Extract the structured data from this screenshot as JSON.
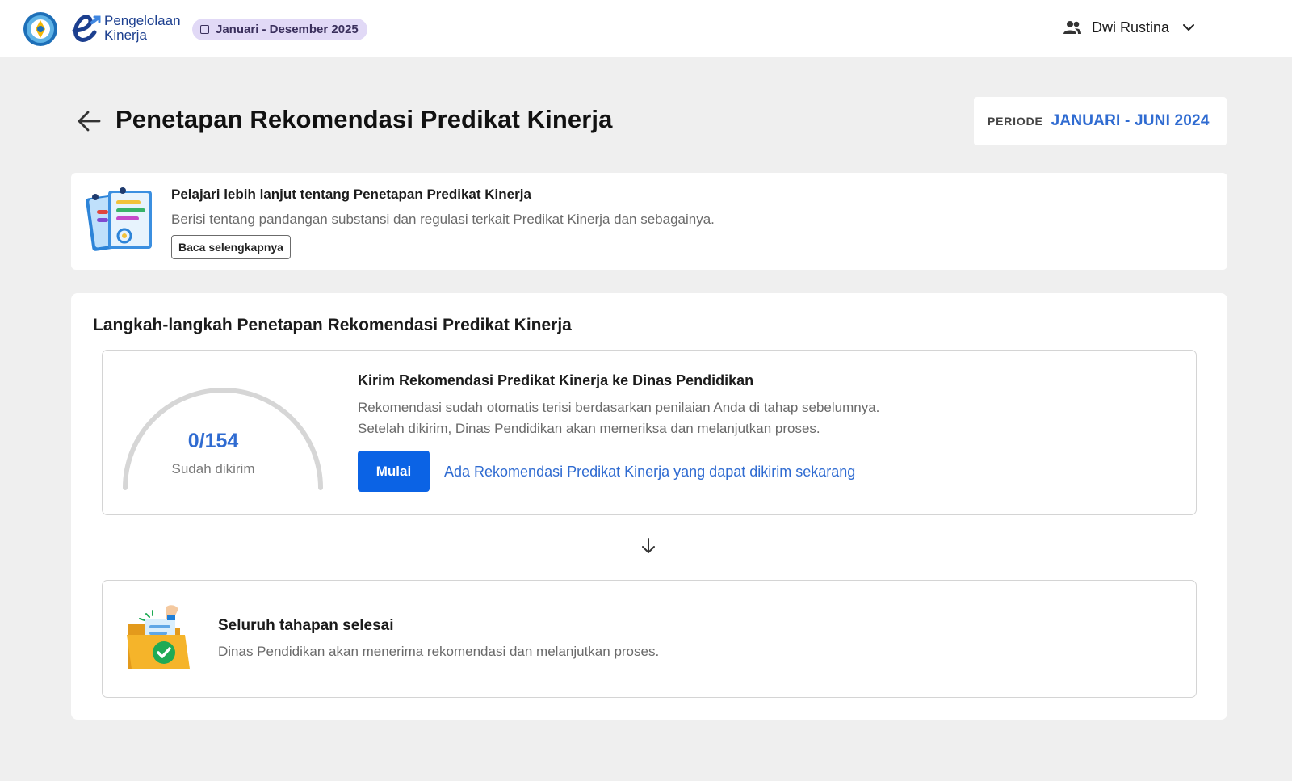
{
  "header": {
    "brand_line1": "Pengelolaan",
    "brand_line2": "Kinerja",
    "period_chip": "Januari - Desember 2025",
    "user_name": "Dwi Rustina"
  },
  "page": {
    "title": "Penetapan Rekomendasi Predikat Kinerja",
    "periode_label": "PERIODE",
    "periode_value": "JANUARI - JUNI 2024"
  },
  "info": {
    "title": "Pelajari lebih lanjut tentang Penetapan Predikat Kinerja",
    "description": "Berisi tentang pandangan substansi dan regulasi terkait Predikat Kinerja dan sebagainya.",
    "button_label": "Baca selengkapnya"
  },
  "steps": {
    "title": "Langkah-langkah Penetapan Rekomendasi Predikat Kinerja",
    "step1": {
      "progress_text": "0/154",
      "progress_sent": 0,
      "progress_total": 154,
      "progress_label": "Sudah dikirim",
      "title": "Kirim Rekomendasi Predikat Kinerja ke Dinas Pendidikan",
      "desc_line1": "Rekomendasi sudah otomatis terisi berdasarkan penilaian Anda di tahap sebelumnya.",
      "desc_line2": "Setelah dikirim, Dinas Pendidikan akan memeriksa dan melanjutkan proses.",
      "button_label": "Mulai",
      "link_text": "Ada Rekomendasi Predikat Kinerja yang dapat dikirim sekarang"
    },
    "step2": {
      "title": "Seluruh tahapan selesai",
      "description": "Dinas Pendidikan akan menerima rekomendasi dan melanjutkan proses."
    }
  },
  "colors": {
    "accent_blue": "#2f6bd1",
    "button_blue": "#0b63e5",
    "chip_purple": "#e1d9f6",
    "page_bg": "#efefef"
  },
  "icons": {
    "emblem": "tut-wuri-handayani-emblem",
    "brand": "e-kinerja-logo-icon",
    "user": "users-icon",
    "chevron": "chevron-down-icon",
    "back": "arrow-left-icon",
    "down": "arrow-down-icon"
  }
}
